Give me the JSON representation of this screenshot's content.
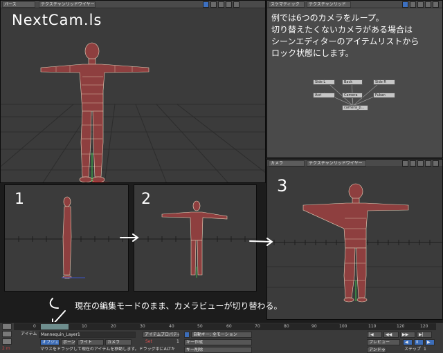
{
  "viewports": {
    "perspective": {
      "view_label": "パース",
      "mode_label": "テクスチャンリッドワイヤー"
    },
    "schematic": {
      "view_label": "スケマティック",
      "mode_label": "テクスチャンリッド"
    },
    "camera": {
      "view_label": "カメラ",
      "mode_label": "テクスチャンリッドワイヤー"
    }
  },
  "annotations": {
    "title": "NextCam.ls",
    "note_line1": "例では6つのカメラをループ。",
    "note_line2": "切り替えたくないカメラがある場合は",
    "note_line3": "シーンエディターのアイテムリストから",
    "note_line4": "ロック状態にします。",
    "step1": "1",
    "step2": "2",
    "step3": "3",
    "bottom_note": "現在の編集モードのまま、カメラビューが切り替わる。"
  },
  "schematic_nodes": [
    "Side L",
    "Back",
    "Side R",
    "Acri",
    "Camera",
    "Fukan",
    "camera_p..."
  ],
  "timeline": {
    "ruler_ticks": [
      "0",
      "10",
      "20",
      "30",
      "40",
      "50",
      "60",
      "70",
      "80",
      "90",
      "100",
      "110",
      "120",
      "120"
    ],
    "item_label": "アイテム",
    "item_value": "Mannequin_Layer1",
    "properties_button": "アイテムプロパティ",
    "auto_key_label": "自動キー: 全モーション",
    "tabs": [
      "オブジェクト",
      "ボーン",
      "ライト",
      "カメラ"
    ],
    "set_label": "Set",
    "set_value": "1",
    "create_key": "キー作成",
    "delete_key": "キー削除",
    "status_text": "マウスをドラッグして現在のアイテムを移動します。ドラッグ中にALTキ",
    "preview_label": "プレビュー",
    "step_label": "ステップ",
    "step_value": "1",
    "undo_label": "アンドゥ",
    "distance": "2 m"
  }
}
